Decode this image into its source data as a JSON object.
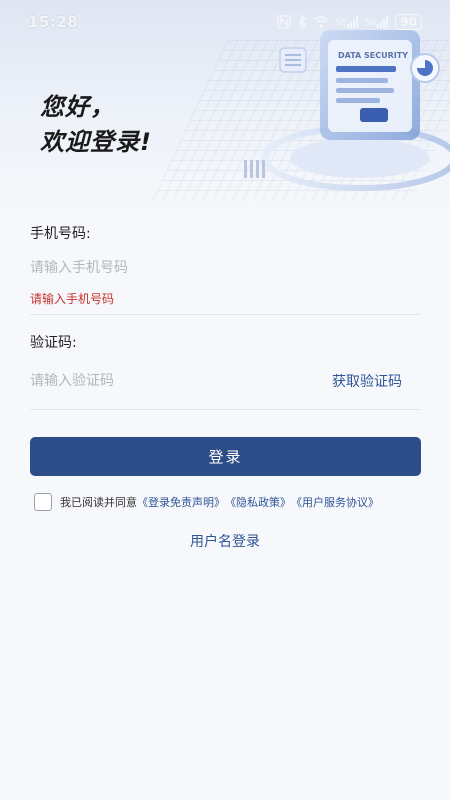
{
  "status_bar": {
    "time": "15:28",
    "nfc_icon": "nfc-icon",
    "bluetooth_icon": "bluetooth-icon",
    "wifi_icon": "wifi-icon",
    "signal1_label": "5G",
    "signal2_label": "5G",
    "battery": "90"
  },
  "greeting": {
    "line1": "您好，",
    "line2": "欢迎登录!"
  },
  "hero": {
    "illustration_text": "DATA SECURITY"
  },
  "phone": {
    "label": "手机号码:",
    "placeholder": "请输入手机号码",
    "error": "请输入手机号码"
  },
  "code": {
    "label": "验证码:",
    "placeholder": "请输入验证码",
    "get_code": "获取验证码"
  },
  "login_button": "登录",
  "agreement": {
    "prefix": "我已阅读并同意",
    "link1": "《登录免责声明》",
    "link2": "《隐私政策》",
    "link3": "《用户服务协议》"
  },
  "username_login": "用户名登录",
  "colors": {
    "primary": "#2c4d87",
    "link": "#2f5597",
    "error": "#c8312e"
  }
}
